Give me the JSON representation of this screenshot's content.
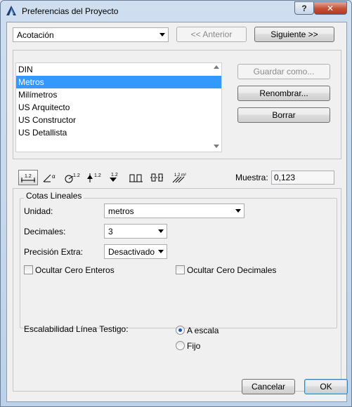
{
  "window": {
    "title": "Preferencias del Proyecto"
  },
  "titlebar": {
    "help_label": "?",
    "close_label": "✕"
  },
  "nav": {
    "category_value": "Acotación",
    "prev_label": "<< Anterior",
    "next_label": "Siguiente >>"
  },
  "presets": {
    "items": [
      {
        "label": "DIN",
        "selected": false
      },
      {
        "label": "Metros",
        "selected": true
      },
      {
        "label": "Milímetros",
        "selected": false
      },
      {
        "label": "US Arquitecto",
        "selected": false
      },
      {
        "label": "US Constructor",
        "selected": false
      },
      {
        "label": "US Detallista",
        "selected": false
      }
    ],
    "save_as_label": "Guardar como...",
    "rename_label": "Renombrar...",
    "delete_label": "Borrar"
  },
  "toolbar": {
    "icons": [
      {
        "name": "linear-dimension-icon",
        "text": "1.2",
        "active": true
      },
      {
        "name": "angular-dimension-icon",
        "text": "α",
        "active": false
      },
      {
        "name": "radial-dimension-icon",
        "text": "1.2",
        "active": false
      },
      {
        "name": "level-dimension-icon",
        "text": "1.2",
        "active": false
      },
      {
        "name": "elevation-dimension-icon",
        "text": "1.2",
        "active": false
      },
      {
        "name": "door-window-dimension-icon",
        "text": "",
        "active": false
      },
      {
        "name": "sill-height-dimension-icon",
        "text": "",
        "active": false
      },
      {
        "name": "area-calculation-icon",
        "text": "1.2 m²",
        "active": false
      }
    ],
    "sample_label": "Muestra:",
    "sample_value": "0,123"
  },
  "linear": {
    "group_title": "Cotas Lineales",
    "unit_label": "Unidad:",
    "unit_value": "metros",
    "decimals_label": "Decimales:",
    "decimals_value": "3",
    "precision_label": "Precisión Extra:",
    "precision_value": "Desactivado",
    "hide_zero_int_label": "Ocultar Cero Enteros",
    "hide_zero_dec_label": "Ocultar Cero Decimales"
  },
  "witness": {
    "label": "Escalabilidad Línea Testigo:",
    "option_scale_label": "A escala",
    "option_fixed_label": "Fijo",
    "selected": "A escala"
  },
  "footer": {
    "cancel_label": "Cancelar",
    "ok_label": "OK"
  },
  "colors": {
    "selection": "#3399ff",
    "window_frame": "#bcd2ea",
    "close_button": "#c45035"
  }
}
